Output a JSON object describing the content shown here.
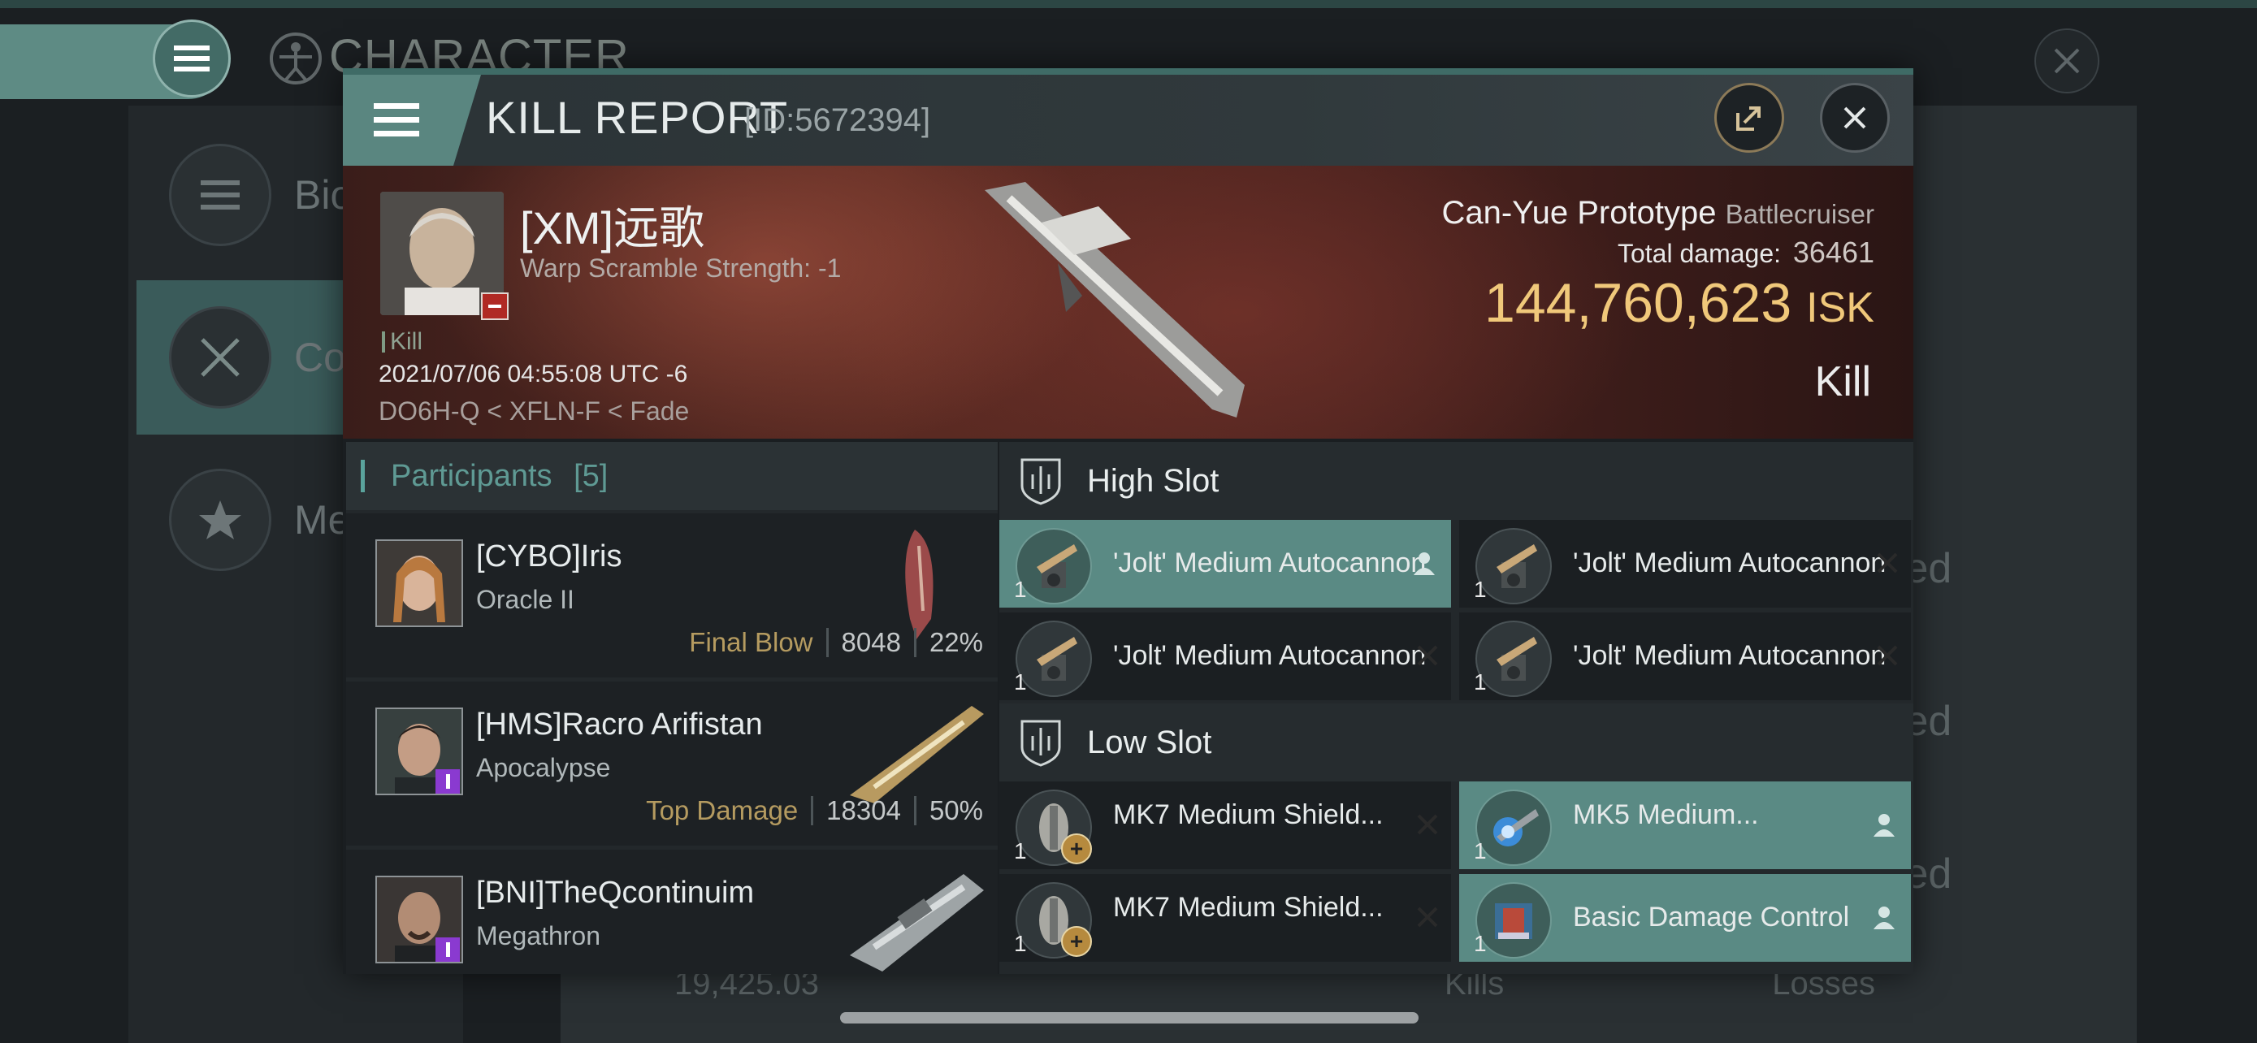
{
  "background": {
    "title": "CHARACTER",
    "tabs": [
      {
        "label": "Bio",
        "icon": "list-icon"
      },
      {
        "label": "Com",
        "icon": "crossed-swords-icon"
      },
      {
        "label": "Med",
        "icon": "star-icon"
      }
    ],
    "right_fragments": [
      "ted",
      "ted",
      "ted"
    ],
    "footer": {
      "value": "19,425.03",
      "kills": "Kills",
      "losses": "Losses"
    }
  },
  "kill_report": {
    "title": "KILL REPORT",
    "id": "[ID:5672394]",
    "victim": {
      "name": "[XM]远歌",
      "subtitle": "Warp Scramble Strength: -1",
      "tag": "Kill",
      "time": "2021/07/06 04:55:08 UTC -6",
      "location": "DO6H-Q < XFLN-F < Fade"
    },
    "ship": {
      "name": "Can-Yue Prototype",
      "class": "Battlecruiser",
      "total_damage_label": "Total damage:",
      "total_damage": "36461",
      "isk_value": "144,760,623",
      "isk_unit": "ISK",
      "result": "Kill"
    },
    "participants": {
      "label": "Participants",
      "count": "[5]",
      "rows": [
        {
          "name": "[CYBO]Iris",
          "ship": "Oracle II",
          "tag": "Final Blow",
          "damage": "8048",
          "percent": "22%"
        },
        {
          "name": "[HMS]Racro Arifistan",
          "ship": "Apocalypse",
          "tag": "Top Damage",
          "damage": "18304",
          "percent": "50%"
        },
        {
          "name": "[BNI]TheQcontinuim",
          "ship": "Megathron",
          "tag": "",
          "damage": "",
          "percent": ""
        }
      ]
    },
    "high_slot": {
      "label": "High Slot",
      "modules": [
        {
          "name": "'Jolt' Medium Autocannon",
          "qty": "1",
          "state": "fitted"
        },
        {
          "name": "'Jolt' Medium Autocannon",
          "qty": "1",
          "state": "destroyed"
        },
        {
          "name": "'Jolt' Medium Autocannon",
          "qty": "1",
          "state": "destroyed"
        },
        {
          "name": "'Jolt' Medium Autocannon",
          "qty": "1",
          "state": "destroyed"
        }
      ]
    },
    "low_slot": {
      "label": "Low Slot",
      "modules": [
        {
          "name": "MK7 Medium Shield...",
          "qty": "1",
          "state": "destroyed"
        },
        {
          "name": "MK5 Medium...",
          "qty": "1",
          "state": "fitted"
        },
        {
          "name": "MK7 Medium Shield...",
          "qty": "1",
          "state": "destroyed"
        },
        {
          "name": "Basic Damage Control",
          "qty": "1",
          "state": "fitted"
        }
      ]
    },
    "colors": {
      "accent": "#5a8a84",
      "isk": "#f0c87a",
      "tag": "#b59b60"
    }
  }
}
